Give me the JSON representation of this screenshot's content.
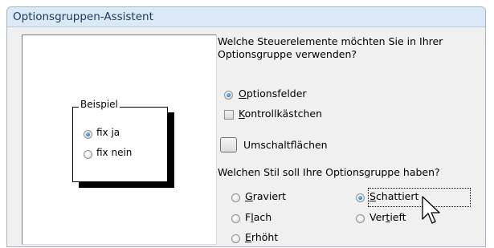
{
  "window": {
    "title": "Optionsgruppen-Assistent"
  },
  "preview": {
    "legend": "Beispiel",
    "options": [
      {
        "label": "fix ja",
        "selected": true
      },
      {
        "label": "fix nein",
        "selected": false
      }
    ]
  },
  "question1": "Welche Steuerelemente möchten Sie in Ihrer Optionsgruppe verwenden?",
  "controls": {
    "optionsfelder": {
      "pre": "",
      "key": "O",
      "post": "ptionsfelder",
      "selected": true
    },
    "kontrollkaestchen": {
      "pre": "",
      "key": "K",
      "post": "ontrollkästchen",
      "selected": false
    },
    "umschaltflaechen": {
      "label": "Umschaltflächen",
      "selected": false
    }
  },
  "question2": "Welchen Stil soll Ihre Optionsgruppe haben?",
  "styles": {
    "graviert": {
      "pre": "",
      "key": "G",
      "post": "raviert",
      "selected": false
    },
    "flach": {
      "pre": "F",
      "key": "l",
      "post": "ach",
      "selected": false
    },
    "erhoeht": {
      "pre": "",
      "key": "E",
      "post": "rhöht",
      "selected": false
    },
    "schattiert": {
      "pre": "",
      "key": "S",
      "post": "chattiert",
      "selected": true
    },
    "vertieft": {
      "pre": "Ver",
      "key": "t",
      "post": "ieft",
      "selected": false
    }
  },
  "colors": {
    "titlebar": "#dbe8f6",
    "title_text": "#1e3a60",
    "dialog_bg": "#f0f0f0",
    "radio_dot": "#1d73c9"
  },
  "icons": {
    "cursor": "arrow-cursor-icon"
  }
}
